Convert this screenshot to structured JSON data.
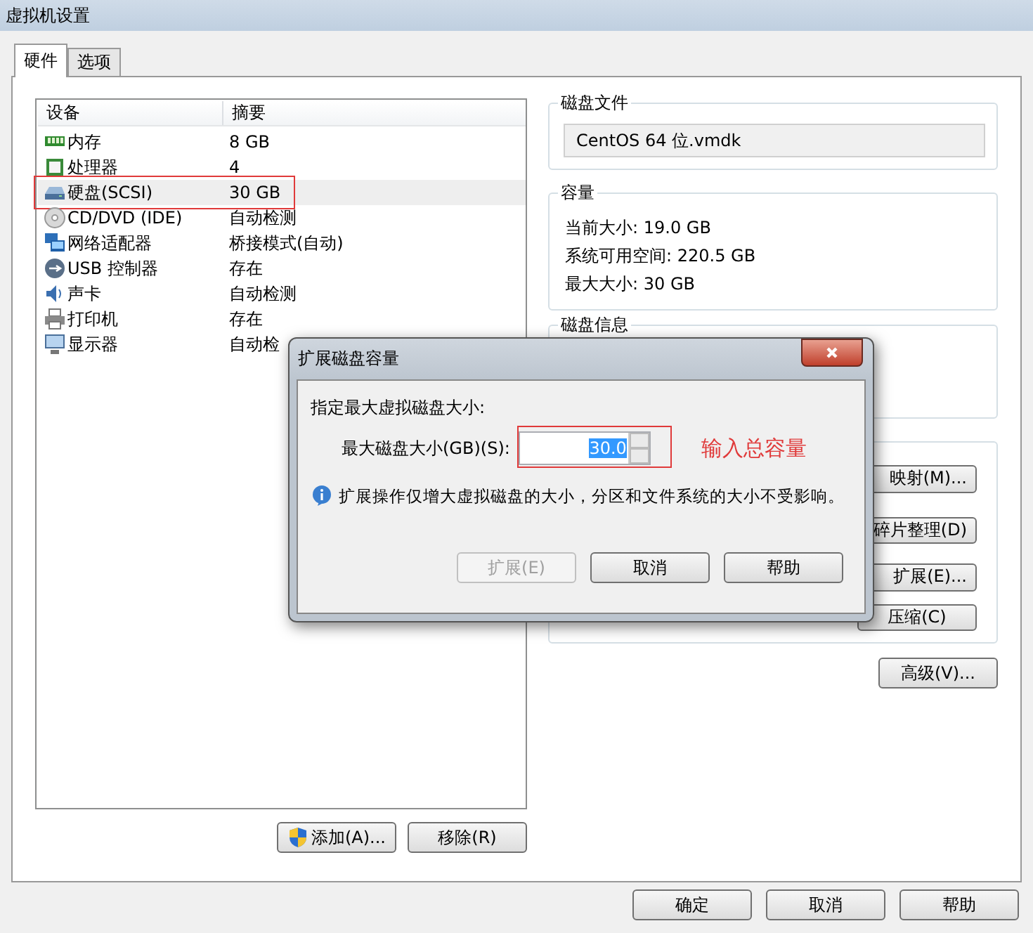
{
  "window": {
    "title": "虚拟机设置"
  },
  "tabs": [
    {
      "label": "硬件",
      "selected": true
    },
    {
      "label": "选项",
      "selected": false
    }
  ],
  "devices": {
    "columns": [
      "设备",
      "摘要"
    ],
    "rows": [
      {
        "kind": "memory",
        "name": "内存",
        "summary": "8 GB",
        "selected": false,
        "annotated": false
      },
      {
        "kind": "cpu",
        "name": "处理器",
        "summary": "4",
        "selected": false,
        "annotated": false
      },
      {
        "kind": "disk",
        "name": "硬盘(SCSI)",
        "summary": "30 GB",
        "selected": true,
        "annotated": true
      },
      {
        "kind": "cd",
        "name": "CD/DVD (IDE)",
        "summary": "自动检测",
        "selected": false,
        "annotated": false
      },
      {
        "kind": "network",
        "name": "网络适配器",
        "summary": "桥接模式(自动)",
        "selected": false,
        "annotated": false
      },
      {
        "kind": "usb",
        "name": "USB 控制器",
        "summary": "存在",
        "selected": false,
        "annotated": false
      },
      {
        "kind": "sound",
        "name": "声卡",
        "summary": "自动检测",
        "selected": false,
        "annotated": false
      },
      {
        "kind": "printer",
        "name": "打印机",
        "summary": "存在",
        "selected": false,
        "annotated": false
      },
      {
        "kind": "display",
        "name": "显示器",
        "summary": "自动检",
        "selected": false,
        "annotated": false
      }
    ]
  },
  "device_buttons": [
    {
      "label": "添加(A)...",
      "kind": "shield"
    },
    {
      "label": "移除(R)",
      "kind": "plain"
    }
  ],
  "disk_file": {
    "title": "磁盘文件",
    "value": "CentOS 64 位.vmdk"
  },
  "capacity": {
    "title": "容量",
    "lines": [
      "当前大小: 19.0 GB",
      "系统可用空间: 220.5 GB",
      "最大大小: 30 GB"
    ]
  },
  "disk_info": {
    "title": "磁盘信息"
  },
  "utility_buttons": [
    "映射(M)...",
    "碎片整理(D)",
    "扩展(E)...",
    "压缩(C)"
  ],
  "advanced_button": "高级(V)...",
  "footer_buttons": [
    "确定",
    "取消",
    "帮助"
  ],
  "dialog": {
    "title": "扩展磁盘容量",
    "prompt": "指定最大虚拟磁盘大小:",
    "field_label": "最大磁盘大小(GB)(S):",
    "value": "30.0",
    "info": "扩展操作仅增大虚拟磁盘的大小，分区和文件系统的大小不受影响。",
    "buttons": [
      {
        "label": "扩展(E)",
        "disabled": true
      },
      {
        "label": "取消",
        "disabled": false
      },
      {
        "label": "帮助",
        "disabled": false
      }
    ],
    "annotation": "输入总容量"
  }
}
